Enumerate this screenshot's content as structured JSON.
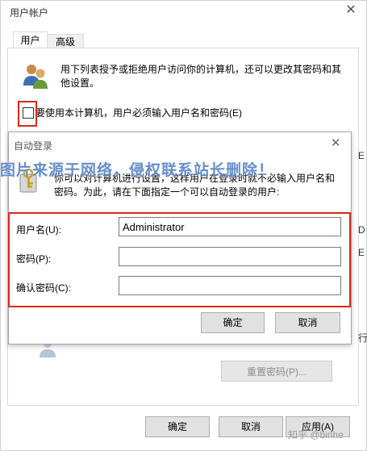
{
  "outer": {
    "title": "用户帐户",
    "close_label": "✕",
    "tabs": [
      {
        "label": "用户"
      },
      {
        "label": "高级"
      }
    ],
    "description": "用下列表授予或拒绝用户访问你的计算机，还可以更改其密码和其他设置。",
    "checkbox_label": "要使用本计算机，用户必须输入用户名和密码(E)",
    "checkbox_checked": false,
    "reset_password_label": "重置密码(P)...",
    "ok_label": "确定",
    "cancel_label": "取消",
    "apply_label": "应用(A)",
    "right_fragments": [
      "E",
      "D",
      "E",
      "行"
    ]
  },
  "inner": {
    "title": "自动登录",
    "close_label": "✕",
    "description": "你可以对计算机进行设置，这样用户在登录时就不必输入用户名和密码。为此，请在下面指定一个可以自动登录的用户:",
    "fields": [
      {
        "label": "用户名(U):",
        "value": "Administrator"
      },
      {
        "label": "密码(P):",
        "value": ""
      },
      {
        "label": "确认密码(C):",
        "value": ""
      }
    ],
    "ok_label": "确定",
    "cancel_label": "取消"
  },
  "watermark": "图片来源于网络，侵权联系站长删除！",
  "brand": "知乎 @binhe",
  "colors": {
    "highlight_red": "#d9281d",
    "watermark_blue": "#5a86c6"
  },
  "icons": [
    "users-icon",
    "key-icon",
    "close-icon"
  ]
}
